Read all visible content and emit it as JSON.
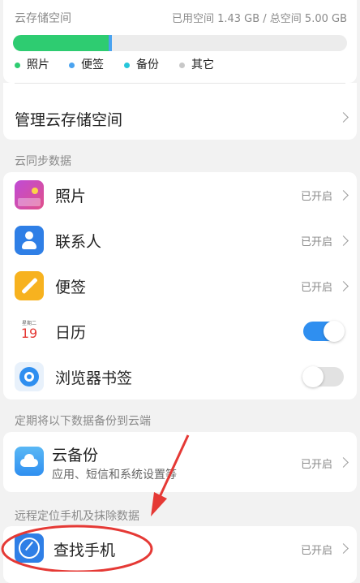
{
  "storage": {
    "title": "云存储空间",
    "usage_text": "已用空间 1.43 GB / 总空间 5.00 GB",
    "used_fraction": 0.286,
    "legend": [
      {
        "label": "照片",
        "color": "#2ecc71"
      },
      {
        "label": "便签",
        "color": "#4aa3f0"
      },
      {
        "label": "备份",
        "color": "#26c6da"
      },
      {
        "label": "其它",
        "color": "#c8c8c8"
      }
    ],
    "manage_label": "管理云存储空间"
  },
  "sync": {
    "section_title": "云同步数据",
    "items": [
      {
        "label": "照片",
        "status": "已开启",
        "icon": "photos-icon"
      },
      {
        "label": "联系人",
        "status": "已开启",
        "icon": "contacts-icon"
      },
      {
        "label": "便签",
        "status": "已开启",
        "icon": "notes-icon"
      },
      {
        "label": "日历",
        "toggle": true,
        "icon": "calendar-icon",
        "calendar_day": "19",
        "calendar_weekday": "星期二"
      },
      {
        "label": "浏览器书签",
        "toggle": false,
        "icon": "browser-icon"
      }
    ]
  },
  "backup": {
    "section_title": "定期将以下数据备份到云端",
    "title": "云备份",
    "subtitle": "应用、短信和系统设置等",
    "status": "已开启",
    "icon": "cloud-icon"
  },
  "locate": {
    "section_title": "远程定位手机及抹除数据",
    "title": "查找手机",
    "status": "已开启",
    "icon": "compass-icon"
  },
  "colors": {
    "accent": "#2f8ff0",
    "storage_green": "#2ecc71"
  }
}
